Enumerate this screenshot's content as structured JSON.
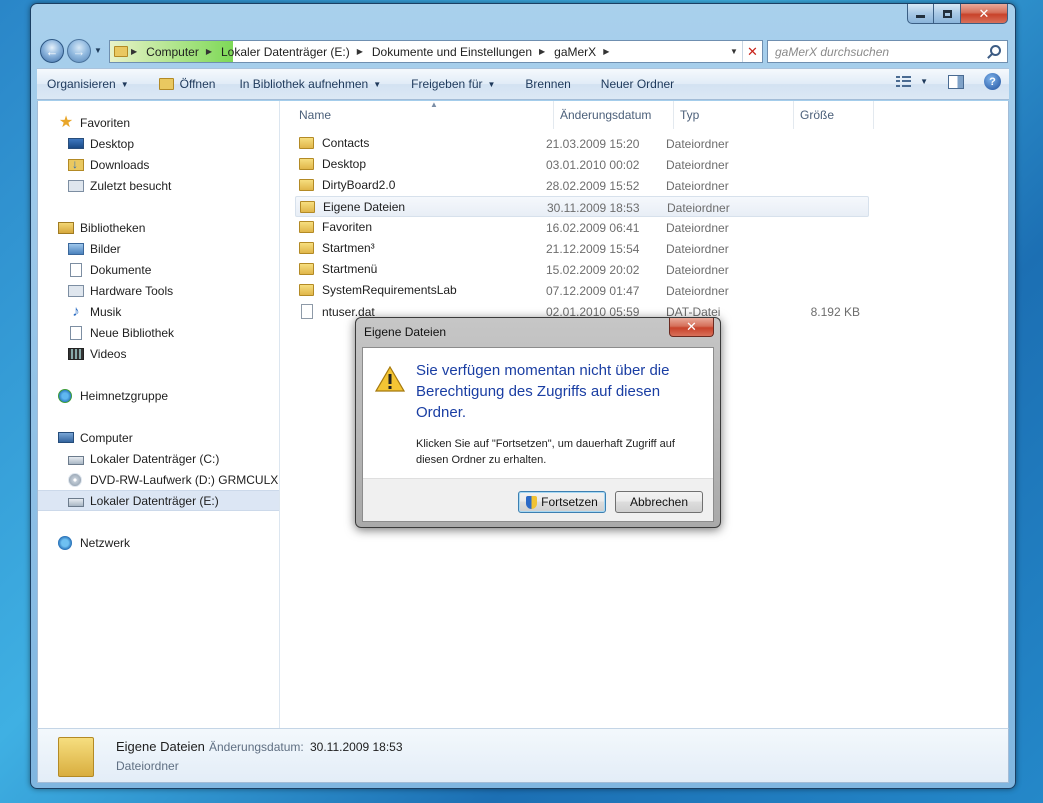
{
  "window": {
    "caption": {
      "minimize": "",
      "maximize": "",
      "close": "✕"
    }
  },
  "address": {
    "crumbs": [
      "Computer",
      "Lokaler Datenträger (E:)",
      "Dokumente und Einstellungen",
      "gaMerX"
    ]
  },
  "search": {
    "placeholder": "gaMerX durchsuchen"
  },
  "toolbar": {
    "organize": "Organisieren",
    "open": "Öffnen",
    "library": "In Bibliothek aufnehmen",
    "share": "Freigeben für",
    "burn": "Brennen",
    "new_folder": "Neuer Ordner"
  },
  "sidebar": {
    "favorites": "Favoriten",
    "desktop": "Desktop",
    "downloads": "Downloads",
    "recent": "Zuletzt besucht",
    "libraries": "Bibliotheken",
    "pictures": "Bilder",
    "documents": "Dokumente",
    "hardware_tools": "Hardware Tools",
    "music": "Musik",
    "new_library": "Neue Bibliothek",
    "videos": "Videos",
    "homegroup": "Heimnetzgruppe",
    "computer": "Computer",
    "drive_c": "Lokaler Datenträger (C:)",
    "drive_d": "DVD-RW-Laufwerk (D:) GRMCULXFF",
    "drive_e": "Lokaler Datenträger (E:)",
    "network": "Netzwerk"
  },
  "columns": {
    "name": "Name",
    "date": "Änderungsdatum",
    "type": "Typ",
    "size": "Größe"
  },
  "files": [
    {
      "name": "Contacts",
      "date": "21.03.2009 15:20",
      "type": "Dateiordner",
      "size": ""
    },
    {
      "name": "Desktop",
      "date": "03.01.2010 00:02",
      "type": "Dateiordner",
      "size": ""
    },
    {
      "name": "DirtyBoard2.0",
      "date": "28.02.2009 15:52",
      "type": "Dateiordner",
      "size": ""
    },
    {
      "name": "Eigene Dateien",
      "date": "30.11.2009 18:53",
      "type": "Dateiordner",
      "size": ""
    },
    {
      "name": "Favoriten",
      "date": "16.02.2009 06:41",
      "type": "Dateiordner",
      "size": ""
    },
    {
      "name": "Startmen³",
      "date": "21.12.2009 15:54",
      "type": "Dateiordner",
      "size": ""
    },
    {
      "name": "Startmenü",
      "date": "15.02.2009 20:02",
      "type": "Dateiordner",
      "size": ""
    },
    {
      "name": "SystemRequirementsLab",
      "date": "07.12.2009 01:47",
      "type": "Dateiordner",
      "size": ""
    },
    {
      "name": "ntuser.dat",
      "date": "02.01.2010 05:59",
      "type": "DAT-Datei",
      "size": "8.192 KB"
    }
  ],
  "details": {
    "name": "Eigene Dateien",
    "date_label": "Änderungsdatum:",
    "date": "30.11.2009 18:53",
    "type": "Dateiordner"
  },
  "dialog": {
    "title": "Eigene Dateien",
    "close": "✕",
    "message": "Sie verfügen momentan nicht über die Berechtigung des Zugriffs auf diesen Ordner.",
    "submessage": "Klicken Sie auf \"Fortsetzen\", um dauerhaft Zugriff auf diesen Ordner zu erhalten.",
    "continue": "Fortsetzen",
    "cancel": "Abbrechen"
  }
}
